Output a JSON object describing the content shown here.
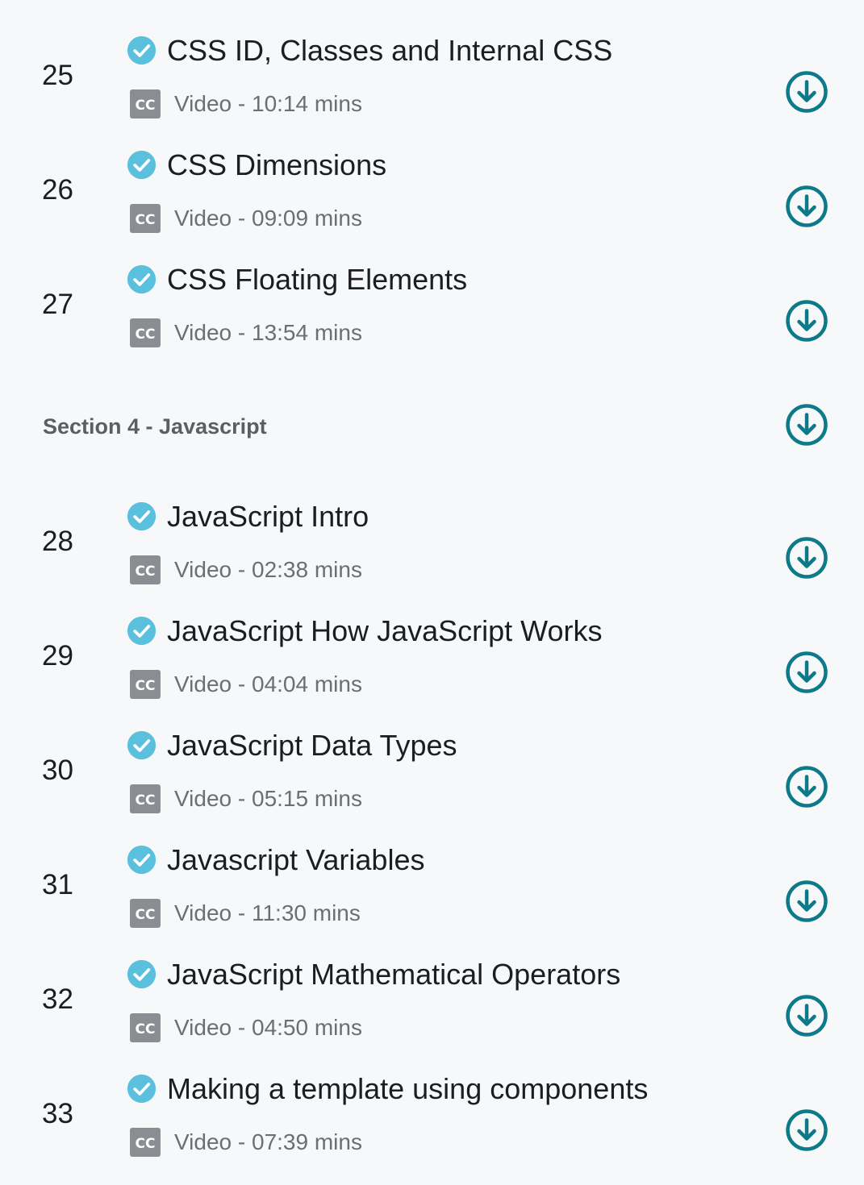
{
  "colors": {
    "check": "#5bc0de",
    "download": "#0d7a8a",
    "cc_badge": "#8a8d91",
    "section_text": "#5a5f63",
    "meta_text": "#6a6f73"
  },
  "icons": {
    "completed": "check-circle-icon",
    "captions": "closed-captions-icon",
    "download": "download-circle-icon",
    "cc_text": "CC"
  },
  "groups": [
    {
      "lessons": [
        {
          "number": "25",
          "title": "CSS ID, Classes and Internal CSS",
          "meta": "Video - 10:14 mins"
        },
        {
          "number": "26",
          "title": "CSS Dimensions",
          "meta": "Video - 09:09 mins"
        },
        {
          "number": "27",
          "title": "CSS Floating Elements",
          "meta": "Video - 13:54 mins"
        }
      ]
    },
    {
      "section_title": "Section 4 - Javascript",
      "lessons": [
        {
          "number": "28",
          "title": "JavaScript Intro",
          "meta": "Video - 02:38 mins"
        },
        {
          "number": "29",
          "title": "JavaScript How JavaScript Works",
          "meta": "Video - 04:04 mins"
        },
        {
          "number": "30",
          "title": "JavaScript Data Types",
          "meta": "Video - 05:15 mins"
        },
        {
          "number": "31",
          "title": "Javascript Variables",
          "meta": "Video - 11:30 mins"
        },
        {
          "number": "32",
          "title": "JavaScript Mathematical Operators",
          "meta": "Video - 04:50 mins"
        },
        {
          "number": "33",
          "title": "Making a template using components",
          "meta": "Video - 07:39 mins"
        }
      ]
    }
  ]
}
